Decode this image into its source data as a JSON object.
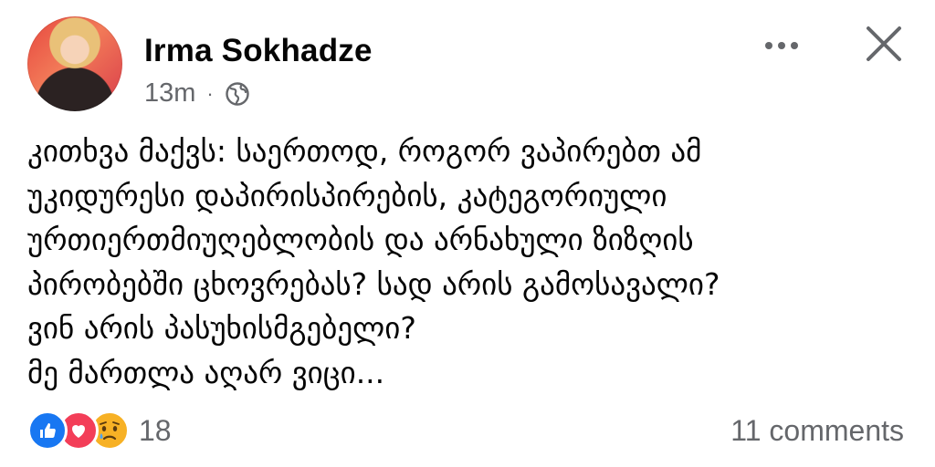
{
  "post": {
    "author": "Irma Sokhadze",
    "time": "13m",
    "separator": "·",
    "privacy_icon": "globe-icon",
    "text_lines": [
      "კითხვა მაქვს: საერთოდ, როგორ ვაპირებთ ამ",
      "უკიდურესი დაპირისპირების, კატეგორიული",
      "ურთიერთმიუღებლობის და არნახული ზიზღის",
      "პირობებში ცხოვრებას? სად არის გამოსავალი?",
      "ვინ არის პასუხისმგებელი?",
      "მე მართლა აღარ ვიცი..."
    ]
  },
  "header_actions": {
    "more_icon": "more-horizontal-icon",
    "close_icon": "close-icon"
  },
  "footer": {
    "reaction_icons": [
      "like-icon",
      "love-icon",
      "sad-icon"
    ],
    "reaction_count": "18",
    "comments": "11 comments"
  },
  "colors": {
    "text": "#050505",
    "secondary": "#65676b",
    "like": "#1877f2",
    "love": "#f33e58",
    "sad": "#f7b125"
  }
}
